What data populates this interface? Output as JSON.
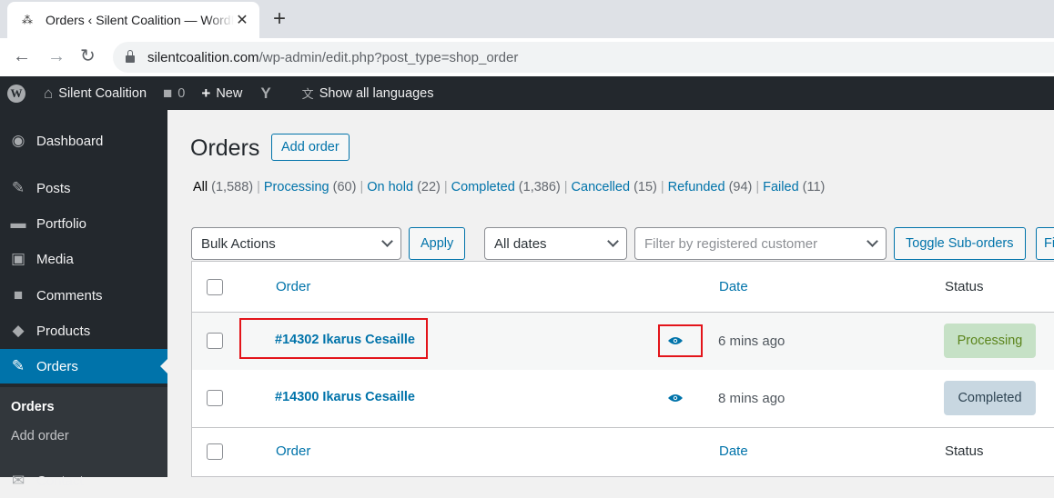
{
  "browser": {
    "tab_title": "Orders ‹ Silent Coalition — WordPress",
    "new_tab": "+",
    "close": "✕",
    "url_domain": "silentcoalition.com",
    "url_path": "/wp-admin/edit.php?post_type=shop_order"
  },
  "adminbar": {
    "site": "Silent Coalition",
    "comments_count": "0",
    "new_label": "New",
    "languages": "Show all languages"
  },
  "sidebar": {
    "items": [
      {
        "label": "Dashboard",
        "icon": "dashboard-icon"
      },
      {
        "label": "Posts",
        "icon": "pin-icon"
      },
      {
        "label": "Portfolio",
        "icon": "folder-icon"
      },
      {
        "label": "Media",
        "icon": "media-icon"
      },
      {
        "label": "Comments",
        "icon": "comment-icon"
      },
      {
        "label": "Products",
        "icon": "box-icon"
      },
      {
        "label": "Orders",
        "icon": "pin-icon"
      },
      {
        "label": "Contact",
        "icon": "mail-icon"
      }
    ],
    "submenu": [
      "Orders",
      "Add order"
    ]
  },
  "main": {
    "title": "Orders",
    "add_button": "Add order",
    "filters": [
      {
        "label": "All",
        "count": "(1,588)"
      },
      {
        "label": "Processing",
        "count": "(60)"
      },
      {
        "label": "On hold",
        "count": "(22)"
      },
      {
        "label": "Completed",
        "count": "(1,386)"
      },
      {
        "label": "Cancelled",
        "count": "(15)"
      },
      {
        "label": "Refunded",
        "count": "(94)"
      },
      {
        "label": "Failed",
        "count": "(11)"
      }
    ],
    "bulk_actions": "Bulk Actions",
    "apply": "Apply",
    "dates": "All dates",
    "customer_placeholder": "Filter by registered customer",
    "toggle_suborders": "Toggle Sub-orders",
    "filter_cut": "Fi"
  },
  "table": {
    "columns": {
      "order": "Order",
      "date": "Date",
      "status": "Status"
    },
    "rows": [
      {
        "order": "#14302 Ikarus Cesaille",
        "date": "6 mins ago",
        "status": "Processing"
      },
      {
        "order": "#14300 Ikarus Cesaille",
        "date": "8 mins ago",
        "status": "Completed"
      }
    ]
  },
  "colors": {
    "accent": "#0073aa",
    "admin_dark": "#23282d",
    "processing_bg": "#c6e1c6",
    "completed_bg": "#c8d7e1",
    "highlight": "#e3141a"
  }
}
